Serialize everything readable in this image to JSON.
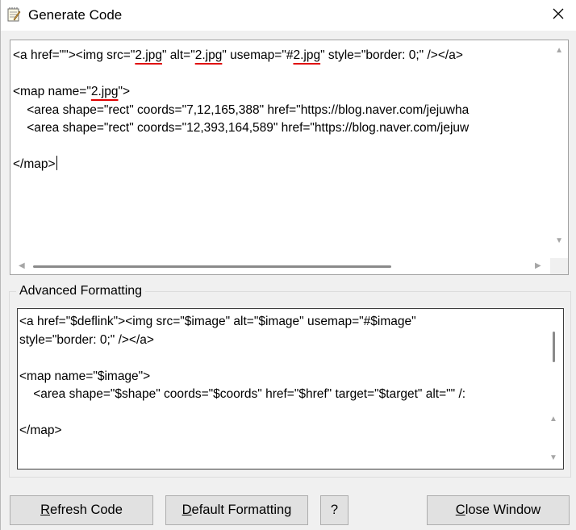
{
  "window": {
    "title": "Generate Code",
    "icon": "notepad-icon",
    "close_icon": "close-icon"
  },
  "code_box": {
    "lines": [
      {
        "parts": [
          {
            "t": "<a href=\"\"><img src=\""
          },
          {
            "t": "2.jpg",
            "squiggle": true
          },
          {
            "t": "\" alt=\""
          },
          {
            "t": "2.jpg",
            "squiggle": true
          },
          {
            "t": "\" usemap=\"#"
          },
          {
            "t": "2.jpg",
            "squiggle": true
          },
          {
            "t": "\" style=\"border: 0;\" /></a>"
          }
        ]
      },
      {
        "parts": []
      },
      {
        "parts": [
          {
            "t": "<map name=\""
          },
          {
            "t": "2.jpg",
            "squiggle": true
          },
          {
            "t": "\">"
          }
        ]
      },
      {
        "parts": [
          {
            "t": "    <area shape=\"rect\" coords=\"7,12,165,388\" href=\"https://blog.naver.com/jejuwha"
          }
        ]
      },
      {
        "parts": [
          {
            "t": "    <area shape=\"rect\" coords=\"12,393,164,589\" href=\"https://blog.naver.com/jejuw"
          }
        ]
      },
      {
        "parts": []
      },
      {
        "parts": [
          {
            "t": "</map>"
          }
        ],
        "caret": true
      }
    ]
  },
  "advanced": {
    "label": "Advanced Formatting",
    "lines": [
      "<a href=\"$deflink\"><img src=\"$image\" alt=\"$image\" usemap=\"#$image\"",
      "style=\"border: 0;\" /></a>",
      "",
      "<map name=\"$image\">",
      "    <area shape=\"$shape\" coords=\"$coords\" href=\"$href\" target=\"$target\" alt=\"\" /:",
      "",
      "</map>"
    ]
  },
  "buttons": {
    "refresh": {
      "pre": "",
      "u": "R",
      "post": "efresh Code"
    },
    "default": {
      "pre": "",
      "u": "D",
      "post": "efault Formatting"
    },
    "help": {
      "pre": "",
      "u": "",
      "post": "?"
    },
    "close": {
      "pre": "",
      "u": "C",
      "post": "lose Window"
    }
  },
  "scroll_arrows": {
    "up": "▲",
    "down": "▼",
    "left": "◀",
    "right": "▶"
  }
}
